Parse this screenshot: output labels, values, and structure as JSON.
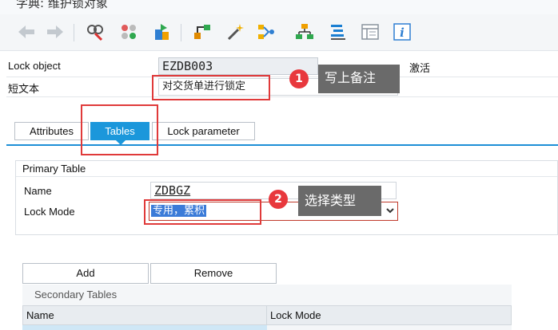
{
  "window": {
    "title": "字典: 维护锁对象"
  },
  "toolbar": {
    "buttons": [
      {
        "name": "back-icon"
      },
      {
        "name": "forward-icon"
      },
      {
        "name": "display-change-icon"
      },
      {
        "name": "active-inactive-icon"
      },
      {
        "name": "other-object-icon"
      },
      {
        "name": "check-icon"
      },
      {
        "name": "activate-icon"
      },
      {
        "name": "where-used-icon"
      },
      {
        "name": "hierarchy-icon"
      },
      {
        "name": "align-icon"
      },
      {
        "name": "table-view-icon"
      },
      {
        "name": "info-icon"
      }
    ]
  },
  "header": {
    "lock_object_label": "Lock object",
    "lock_object_value": "EZDB003",
    "status": "激活",
    "short_text_label": "短文本",
    "short_text_value": "对交货单进行锁定"
  },
  "tabs": [
    {
      "label": "Attributes",
      "active": false
    },
    {
      "label": "Tables",
      "active": true
    },
    {
      "label": "Lock parameter",
      "active": false
    }
  ],
  "primary_table": {
    "title": "Primary Table",
    "name_label": "Name",
    "name_value": "ZDBGZ",
    "lock_mode_label": "Lock Mode",
    "lock_mode_value": "专用，累积"
  },
  "annotations": [
    {
      "number": "1",
      "text": "写上备注"
    },
    {
      "number": "2",
      "text": "选择类型"
    }
  ],
  "buttons": {
    "add": "Add",
    "remove": "Remove"
  },
  "secondary_tables": {
    "title": "Secondary Tables",
    "columns": [
      "Name",
      "Lock Mode"
    ]
  },
  "colors": {
    "accent": "#1b97db",
    "annotation": "#e03a3a",
    "callout": "#6a6a6a"
  }
}
